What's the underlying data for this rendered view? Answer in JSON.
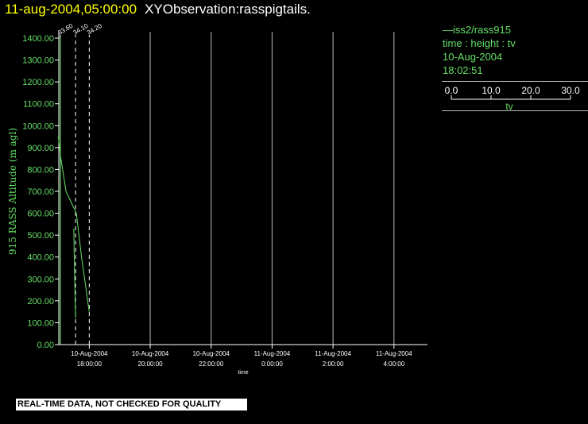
{
  "header": {
    "datetime": "11-aug-2004,05:00:00",
    "name": "XYObservation:rasspigtails."
  },
  "legend": {
    "series": "iss2/rass915",
    "subtitle": "time : height : tv",
    "date": "10-Aug-2004",
    "time": "18:02:51",
    "scale_ticks": [
      "0.0",
      "10.0",
      "20.0",
      "30.0"
    ],
    "scale_label": "tv"
  },
  "notice": "REAL-TIME DATA, NOT CHECKED FOR QUALITY",
  "colors": {
    "background": "#000000",
    "axis": "#ffffff",
    "ytext": "#66e066",
    "series": "#66e066",
    "title_date": "#ffff00"
  },
  "chart_data": {
    "type": "line",
    "ylabel": "915 RASS Altitude (m agl)",
    "xlabel": "time",
    "ylim": [
      0,
      1400
    ],
    "y_ticks": [
      "0.00",
      "100.00",
      "200.00",
      "300.00",
      "400.00",
      "500.00",
      "600.00",
      "700.00",
      "800.00",
      "900.00",
      "1000.00",
      "1100.00",
      "1200.00",
      "1300.00",
      "1400.00"
    ],
    "x_hours_range": [
      17,
      29.1
    ],
    "x_ticks": [
      {
        "date": "10-Aug-2004",
        "time": "18:00:00",
        "h": 18
      },
      {
        "date": "10-Aug-2004",
        "time": "20:00:00",
        "h": 20
      },
      {
        "date": "10-Aug-2004",
        "time": "22:00:00",
        "h": 22
      },
      {
        "date": "11-Aug-2004",
        "time": "0:00:00",
        "h": 24
      },
      {
        "date": "11-Aug-2004",
        "time": "2:00:00",
        "h": 26
      },
      {
        "date": "11-Aug-2004",
        "time": "4:00:00",
        "h": 28
      }
    ],
    "profiles": [
      {
        "label": "33.60",
        "h": 17.05,
        "dashed": false,
        "tv_min": 0,
        "tv_max": 30,
        "values": [
          [
            0,
            1400
          ],
          [
            0,
            1380
          ],
          [
            0,
            1100
          ],
          [
            0,
            200
          ],
          [
            0,
            180
          ],
          [
            0,
            0
          ]
        ]
      },
      {
        "label": "34.10",
        "h": 17.55,
        "dashed": true,
        "tv_min": 0,
        "tv_max": 30,
        "values": [
          [
            -1.7,
            530
          ],
          [
            -1.3,
            400
          ],
          [
            0,
            120
          ]
        ]
      },
      {
        "label": "34.20",
        "h": 18.0,
        "dashed": true,
        "tv_min": 0,
        "tv_max": 30,
        "values": [
          [
            -30,
            950
          ],
          [
            -27.5,
            850
          ],
          [
            -22.5,
            700
          ],
          [
            -12.5,
            600
          ],
          [
            -7.5,
            400
          ],
          [
            0,
            150
          ]
        ]
      }
    ]
  }
}
